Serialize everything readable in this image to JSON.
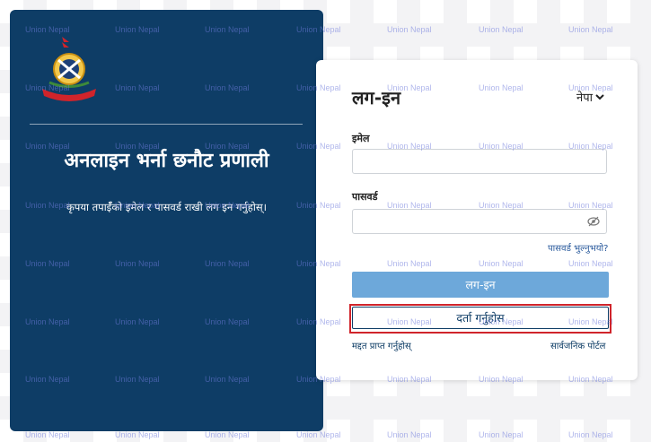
{
  "left": {
    "title": "अनलाइन भर्ना छनौट प्रणाली",
    "subtitle": "कृपया तपाईँको इमेल र पासवर्ड राखी लग इन गर्नुहोस्।"
  },
  "card": {
    "title": "लग-इन",
    "language": "नेपा",
    "email_label": "इमेल",
    "email_value": "",
    "password_label": "पासवर्ड",
    "password_value": "",
    "forgot": "पासवर्ड भुल्नुभयो?",
    "login_button": "लग-इन",
    "register_button": "दर्ता गर्नुहोस",
    "help": "मद्दत प्राप्त गर्नुहोस्",
    "public_portal": "सार्वजनिक पोर्टल"
  },
  "watermark": "Union Nepal",
  "icons": [
    "police-emblem-icon",
    "chevron-down-icon",
    "eye-off-icon"
  ],
  "colors": {
    "panel": "#0e3d66",
    "login_button": "#6da8da",
    "highlight": "#d0242b",
    "link": "#2a5a9c"
  }
}
